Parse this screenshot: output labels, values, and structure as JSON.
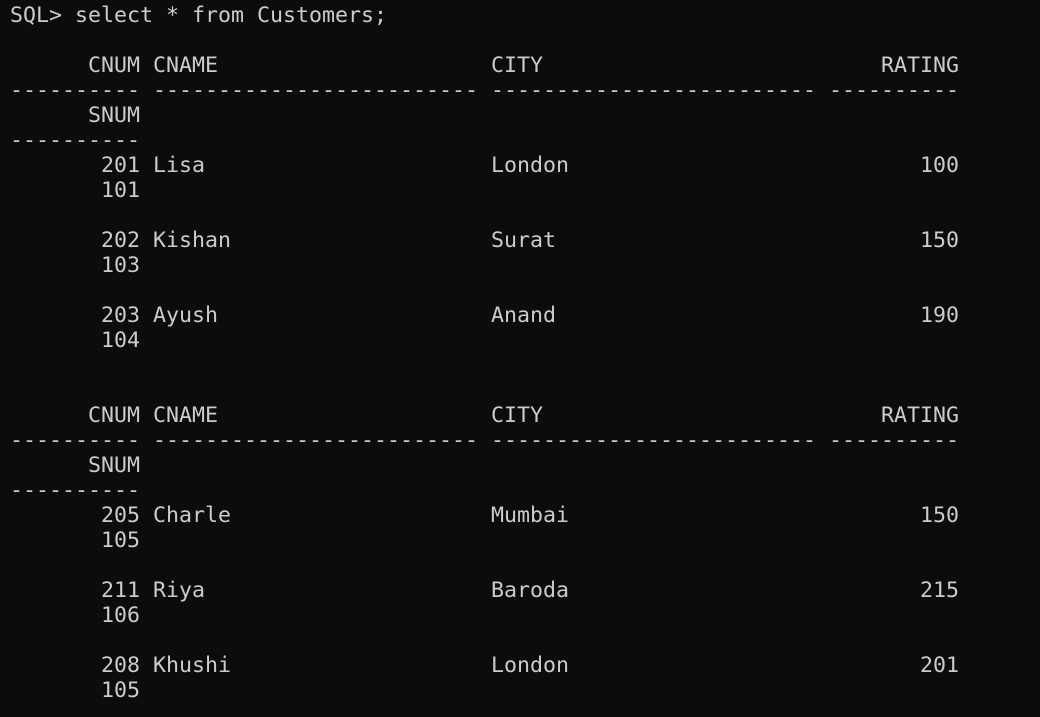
{
  "terminal": {
    "prompt": "SQL>",
    "command": "select * from Customers;",
    "rows": [
      "",
      "      CNUM CNAME                     CITY                          RATING",
      "---------- ------------------------- ------------------------- ----------",
      "      SNUM",
      "----------",
      "       201 Lisa                      London                           100",
      "       101",
      "",
      "       202 Kishan                    Surat                            150",
      "       103",
      "",
      "       203 Ayush                     Anand                            190",
      "       104",
      "",
      "",
      "      CNUM CNAME                     CITY                          RATING",
      "---------- ------------------------- ------------------------- ----------",
      "      SNUM",
      "----------",
      "       205 Charle                    Mumbai                           150",
      "       105",
      "",
      "       211 Riya                      Baroda                           215",
      "       106",
      "",
      "       208 Khushi                    London                           201",
      "       105"
    ]
  }
}
